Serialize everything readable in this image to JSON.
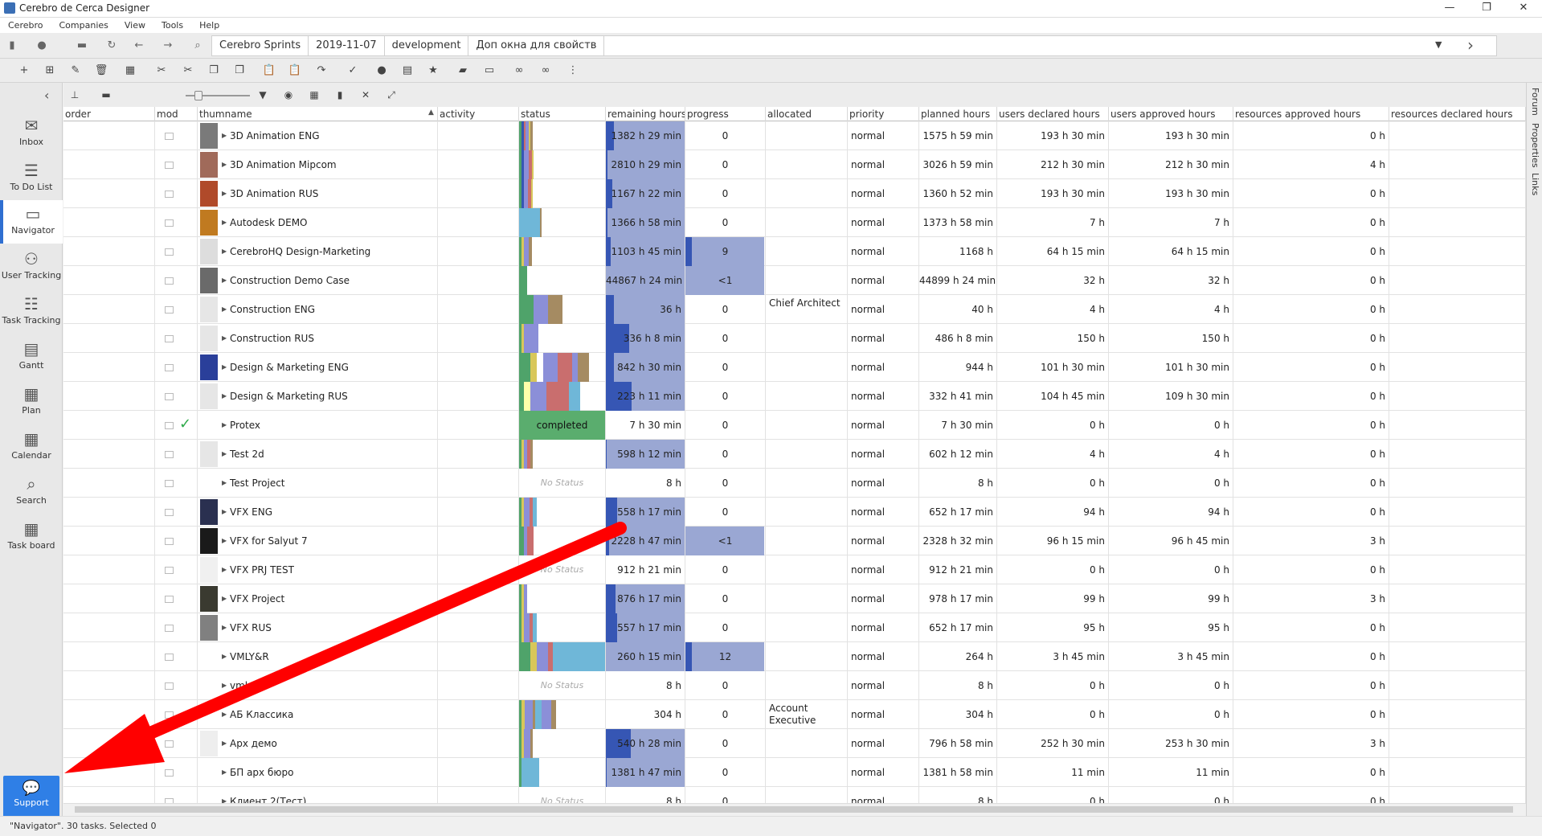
{
  "window": {
    "title": "Cerebro de Cerca  Designer",
    "controls": [
      "—",
      "❐",
      "✕"
    ]
  },
  "menu": [
    "Cerebro",
    "Companies",
    "View",
    "Tools",
    "Help"
  ],
  "breadcrumb": [
    "Cerebro Sprints",
    "2019-11-07",
    "development",
    "Доп окна для свойств"
  ],
  "sidebar": [
    {
      "label": "Inbox",
      "icon": "inbox-icon",
      "active": false
    },
    {
      "label": "To Do List",
      "icon": "todo-list-icon",
      "active": false
    },
    {
      "label": "Navigator",
      "icon": "navigator-icon",
      "active": true
    },
    {
      "label": "User Tracking",
      "icon": "user-tracking-icon",
      "active": false
    },
    {
      "label": "Task Tracking",
      "icon": "task-tracking-icon",
      "active": false
    },
    {
      "label": "Gantt",
      "icon": "gantt-icon",
      "active": false
    },
    {
      "label": "Plan",
      "icon": "plan-icon",
      "active": false
    },
    {
      "label": "Calendar",
      "icon": "calendar-icon",
      "active": false
    },
    {
      "label": "Search",
      "icon": "search-icon",
      "active": false
    },
    {
      "label": "Task board",
      "icon": "task-board-icon",
      "active": false
    }
  ],
  "support": {
    "label": "Support"
  },
  "right_tabs": [
    "Forum",
    "Properties",
    "Links"
  ],
  "columns": [
    "order",
    "mod",
    "thumname",
    "activity",
    "status",
    "remaining hours",
    "progress",
    "allocated",
    "priority",
    "planned hours",
    "users declared hours",
    "users approved hours",
    "resources approved hours",
    "resources declared hours"
  ],
  "rows": [
    {
      "name": "3D Animation ENG",
      "status": [
        [
          "#4fa36a",
          3
        ],
        [
          "#3656b4",
          3
        ],
        [
          "#c96e6e",
          2
        ],
        [
          "#8b8fd8",
          4
        ],
        [
          "#d8c75a",
          2
        ],
        [
          "#a58b62",
          3
        ]
      ],
      "status_text": "",
      "remaining": "1382 h 29 min",
      "rem_fill": 0.1,
      "progress": "0",
      "prog_fill": 0,
      "allocated": "",
      "priority": "normal",
      "planned": "1575 h 59 min",
      "udh": "193 h 30 min",
      "uah": "193 h 30 min",
      "rah": "0 h",
      "thumb": "#7a7a7a"
    },
    {
      "name": "3D Animation Mipcom",
      "status": [
        [
          "#4fa36a",
          3
        ],
        [
          "#3656b4",
          3
        ],
        [
          "#8b8fd8",
          6
        ],
        [
          "#c96e6e",
          4
        ],
        [
          "#d8c75a",
          2
        ]
      ],
      "status_text": "",
      "remaining": "2810 h 29 min",
      "rem_fill": 0.02,
      "progress": "0",
      "prog_fill": 0,
      "allocated": "",
      "priority": "normal",
      "planned": "3026 h 59 min",
      "udh": "212 h 30 min",
      "uah": "212 h 30 min",
      "rah": "4 h",
      "thumb": "#a06a5a"
    },
    {
      "name": "3D Animation RUS",
      "status": [
        [
          "#4fa36a",
          3
        ],
        [
          "#3656b4",
          3
        ],
        [
          "#8b8fd8",
          5
        ],
        [
          "#c96e6e",
          4
        ],
        [
          "#d8c75a",
          2
        ]
      ],
      "status_text": "",
      "remaining": "1167 h 22 min",
      "rem_fill": 0.08,
      "progress": "0",
      "prog_fill": 0,
      "allocated": "",
      "priority": "normal",
      "planned": "1360 h 52 min",
      "udh": "193 h 30 min",
      "uah": "193 h 30 min",
      "rah": "0 h",
      "thumb": "#b04a2a"
    },
    {
      "name": "Autodesk DEMO",
      "status": [
        [
          "#6fb7d8",
          26
        ],
        [
          "#a58b62",
          2
        ]
      ],
      "status_text": "",
      "remaining": "1366 h 58 min",
      "rem_fill": 0.02,
      "progress": "0",
      "prog_fill": 0,
      "allocated": "",
      "priority": "normal",
      "planned": "1373 h 58 min",
      "udh": "7 h",
      "uah": "7 h",
      "rah": "0 h",
      "thumb": "#c07a20"
    },
    {
      "name": "CerebroHQ Design-Marketing",
      "status": [
        [
          "#4fa36a",
          3
        ],
        [
          "#d8c75a",
          3
        ],
        [
          "#8b8fd8",
          6
        ],
        [
          "#a58b62",
          4
        ]
      ],
      "status_text": "",
      "remaining": "1103 h 45 min",
      "rem_fill": 0.06,
      "progress": "9",
      "prog_fill": 1,
      "allocated": "",
      "priority": "normal",
      "planned": "1168 h",
      "udh": "64 h 15 min",
      "uah": "64 h 15 min",
      "rah": "0 h",
      "thumb": "#dddddd"
    },
    {
      "name": "Construction Demo Case",
      "status": [
        [
          "#4fa36a",
          10
        ]
      ],
      "status_text": "",
      "remaining": "44867 h 24 min",
      "rem_fill": 0,
      "progress": "<1",
      "prog_fill": 1,
      "allocated": "",
      "priority": "normal",
      "planned": "44899 h 24 min",
      "udh": "32 h",
      "uah": "32 h",
      "rah": "0 h",
      "thumb": "#6a6a6a"
    },
    {
      "name": "Construction ENG",
      "status": [
        [
          "#4fa36a",
          18
        ],
        [
          "#8b8fd8",
          18
        ],
        [
          "#a58b62",
          18
        ]
      ],
      "status_text": "",
      "remaining": "36 h",
      "rem_fill": 0.1,
      "progress": "0",
      "prog_fill": 0,
      "allocated": "Chief Architect",
      "priority": "normal",
      "planned": "40 h",
      "udh": "4 h",
      "uah": "4 h",
      "rah": "0 h",
      "thumb": "#e6e6e6"
    },
    {
      "name": "Construction RUS",
      "status": [
        [
          "#4fa36a",
          3
        ],
        [
          "#d8c75a",
          3
        ],
        [
          "#8b8fd8",
          18
        ]
      ],
      "status_text": "",
      "remaining": "336 h 8 min",
      "rem_fill": 0.3,
      "progress": "0",
      "prog_fill": 0,
      "allocated": "",
      "priority": "normal",
      "planned": "486 h 8 min",
      "udh": "150 h",
      "uah": "150 h",
      "rah": "0 h",
      "thumb": "#e6e6e6"
    },
    {
      "name": "Design & Marketing ENG",
      "status": [
        [
          "#4fa36a",
          14
        ],
        [
          "#d8c75a",
          8
        ],
        [
          "#ffffff",
          8
        ],
        [
          "#8b8fd8",
          18
        ],
        [
          "#c96e6e",
          18
        ],
        [
          "#8b8fd8",
          7
        ],
        [
          "#a58b62",
          14
        ]
      ],
      "status_text": "",
      "remaining": "842 h 30 min",
      "rem_fill": 0.1,
      "progress": "0",
      "prog_fill": 0,
      "allocated": "",
      "priority": "normal",
      "planned": "944 h",
      "udh": "101 h 30 min",
      "uah": "101 h 30 min",
      "rah": "0 h",
      "thumb": "#2a3f9a"
    },
    {
      "name": "Design & Marketing RUS",
      "status": [
        [
          "#4fa36a",
          6
        ],
        [
          "#ffffaa",
          8
        ],
        [
          "#8b8fd8",
          20
        ],
        [
          "#c96e6e",
          28
        ],
        [
          "#6fb7d8",
          14
        ]
      ],
      "status_text": "",
      "remaining": "223 h 11 min",
      "rem_fill": 0.33,
      "progress": "0",
      "prog_fill": 0,
      "allocated": "",
      "priority": "normal",
      "planned": "332 h 41 min",
      "udh": "104 h 45 min",
      "uah": "109 h 30 min",
      "rah": "0 h",
      "thumb": "#e6e6e6"
    },
    {
      "name": "Protex",
      "status": [],
      "status_text": "completed",
      "remaining": "7 h 30 min",
      "rem_fill": 0,
      "progress": "0",
      "prog_fill": 0,
      "allocated": "",
      "priority": "normal",
      "planned": "7 h 30 min",
      "udh": "0 h",
      "uah": "0 h",
      "rah": "0 h",
      "thumb": "",
      "checked": true
    },
    {
      "name": "Test 2d",
      "status": [
        [
          "#4fa36a",
          3
        ],
        [
          "#d8c75a",
          3
        ],
        [
          "#8b8fd8",
          4
        ],
        [
          "#c96e6e",
          4
        ],
        [
          "#a58b62",
          3
        ]
      ],
      "status_text": "",
      "remaining": "598 h 12 min",
      "rem_fill": 0.01,
      "progress": "0",
      "prog_fill": 0,
      "allocated": "",
      "priority": "normal",
      "planned": "602 h 12 min",
      "udh": "4 h",
      "uah": "4 h",
      "rah": "0 h",
      "thumb": "#e6e6e6"
    },
    {
      "name": "Test Project",
      "status": [],
      "status_text": "No Status",
      "remaining": "8 h",
      "rem_fill": 0,
      "progress": "0",
      "prog_fill": 0,
      "allocated": "",
      "priority": "normal",
      "planned": "8 h",
      "udh": "0 h",
      "uah": "0 h",
      "rah": "0 h",
      "thumb": ""
    },
    {
      "name": "VFX ENG",
      "status": [
        [
          "#4fa36a",
          3
        ],
        [
          "#d8c75a",
          3
        ],
        [
          "#8b8fd8",
          7
        ],
        [
          "#c96e6e",
          4
        ],
        [
          "#6fb7d8",
          5
        ]
      ],
      "status_text": "",
      "remaining": "558 h 17 min",
      "rem_fill": 0.14,
      "progress": "0",
      "prog_fill": 0,
      "allocated": "",
      "priority": "normal",
      "planned": "652 h 17 min",
      "udh": "94 h",
      "uah": "94 h",
      "rah": "0 h",
      "thumb": "#2a3050"
    },
    {
      "name": "VFX for Salyut 7",
      "status": [
        [
          "#4fa36a",
          6
        ],
        [
          "#8b8fd8",
          4
        ],
        [
          "#c96e6e",
          8
        ]
      ],
      "status_text": "",
      "remaining": "2228 h 47 min",
      "rem_fill": 0.04,
      "progress": "<1",
      "prog_fill": 1,
      "allocated": "",
      "priority": "normal",
      "planned": "2328 h 32 min",
      "udh": "96 h 15 min",
      "uah": "96 h 45 min",
      "rah": "3 h",
      "thumb": "#1a1a1a"
    },
    {
      "name": "VFX PRJ TEST",
      "status": [],
      "status_text": "No Status",
      "remaining": "912 h 21 min",
      "rem_fill": 0,
      "progress": "0",
      "prog_fill": 0,
      "allocated": "",
      "priority": "normal",
      "planned": "912 h 21 min",
      "udh": "0 h",
      "uah": "0 h",
      "rah": "0 h",
      "thumb": "#f0f0f0"
    },
    {
      "name": "VFX Project",
      "status": [
        [
          "#4fa36a",
          3
        ],
        [
          "#d8c75a",
          3
        ],
        [
          "#8b8fd8",
          4
        ]
      ],
      "status_text": "",
      "remaining": "876 h 17 min",
      "rem_fill": 0.12,
      "progress": "0",
      "prog_fill": 0,
      "allocated": "",
      "priority": "normal",
      "planned": "978 h 17 min",
      "udh": "99 h",
      "uah": "99 h",
      "rah": "3 h",
      "thumb": "#3a3a30"
    },
    {
      "name": "VFX RUS",
      "status": [
        [
          "#4fa36a",
          3
        ],
        [
          "#d8c75a",
          3
        ],
        [
          "#8b8fd8",
          7
        ],
        [
          "#c96e6e",
          4
        ],
        [
          "#6fb7d8",
          5
        ]
      ],
      "status_text": "",
      "remaining": "557 h 17 min",
      "rem_fill": 0.14,
      "progress": "0",
      "prog_fill": 0,
      "allocated": "",
      "priority": "normal",
      "planned": "652 h 17 min",
      "udh": "95 h",
      "uah": "95 h",
      "rah": "0 h",
      "thumb": "#808080"
    },
    {
      "name": "VMLY&R",
      "status": [
        [
          "#4fa36a",
          14
        ],
        [
          "#d8c75a",
          8
        ],
        [
          "#8b8fd8",
          14
        ],
        [
          "#c96e6e",
          6
        ],
        [
          "#6fb7d8",
          66
        ]
      ],
      "status_text": "",
      "remaining": "260 h 15 min",
      "rem_fill": 0,
      "progress": "12",
      "prog_fill": 1,
      "allocated": "",
      "priority": "normal",
      "planned": "264 h",
      "udh": "3 h 45 min",
      "uah": "3 h 45 min",
      "rah": "0 h",
      "thumb": ""
    },
    {
      "name": "vmly",
      "status": [],
      "status_text": "No Status",
      "remaining": "8 h",
      "rem_fill": 0,
      "progress": "0",
      "prog_fill": 0,
      "allocated": "",
      "priority": "normal",
      "planned": "8 h",
      "udh": "0 h",
      "uah": "0 h",
      "rah": "0 h",
      "thumb": ""
    },
    {
      "name": "АБ Классика",
      "status": [
        [
          "#4fa36a",
          3
        ],
        [
          "#d8c75a",
          4
        ],
        [
          "#8b8fd8",
          10
        ],
        [
          "#a58b62",
          3
        ],
        [
          "#6fb7d8",
          8
        ],
        [
          "#8b8fd8",
          12
        ],
        [
          "#a58b62",
          6
        ]
      ],
      "status_text": "",
      "remaining": "304 h",
      "rem_fill": 0,
      "progress": "0",
      "prog_fill": 0,
      "allocated": "Account Executive",
      "priority": "normal",
      "planned": "304 h",
      "udh": "0 h",
      "uah": "0 h",
      "rah": "0 h",
      "thumb": ""
    },
    {
      "name": "Арх демо",
      "status": [
        [
          "#4fa36a",
          3
        ],
        [
          "#d8c75a",
          3
        ],
        [
          "#8b8fd8",
          8
        ],
        [
          "#a58b62",
          3
        ]
      ],
      "status_text": "",
      "remaining": "540 h 28 min",
      "rem_fill": 0.32,
      "progress": "0",
      "prog_fill": 0,
      "allocated": "",
      "priority": "normal",
      "planned": "796 h 58 min",
      "udh": "252 h 30 min",
      "uah": "253 h 30 min",
      "rah": "3 h",
      "thumb": "#eeeeee"
    },
    {
      "name": "БП арх бюро",
      "status": [
        [
          "#4fa36a",
          3
        ],
        [
          "#6fb7d8",
          22
        ]
      ],
      "status_text": "",
      "remaining": "1381 h 47 min",
      "rem_fill": 0.01,
      "progress": "0",
      "prog_fill": 0,
      "allocated": "",
      "priority": "normal",
      "planned": "1381 h 58 min",
      "udh": "11 min",
      "uah": "11 min",
      "rah": "0 h",
      "thumb": ""
    },
    {
      "name": "Клиент 2(Тест)",
      "status": [],
      "status_text": "No Status",
      "remaining": "8 h",
      "rem_fill": 0,
      "progress": "0",
      "prog_fill": 0,
      "allocated": "",
      "priority": "normal",
      "planned": "8 h",
      "udh": "0 h",
      "uah": "0 h",
      "rah": "0 h",
      "thumb": ""
    }
  ],
  "statusbar": "\"Navigator\". 30 tasks. Selected 0",
  "accent_color": "#2f7fe6",
  "annotation_arrow_color": "#ff0000"
}
